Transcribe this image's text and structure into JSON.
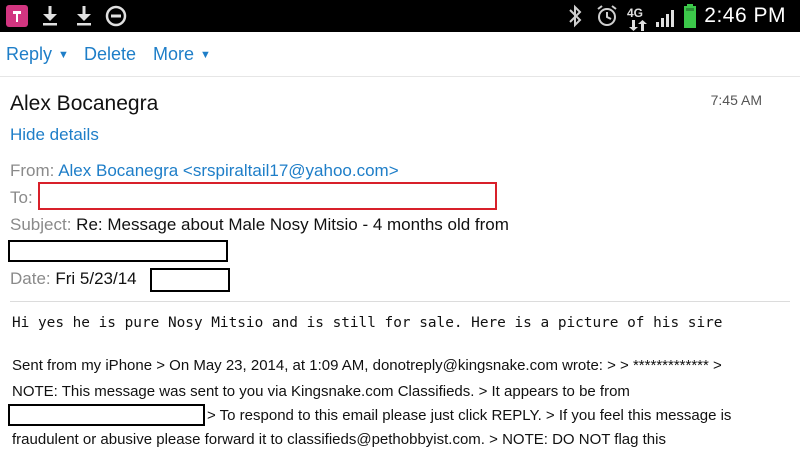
{
  "status_bar": {
    "time": "2:46 PM",
    "icons": [
      "t-mobile-icon",
      "download-icon",
      "download-icon",
      "do-not-disturb-icon",
      "bluetooth-icon",
      "alarm-icon",
      "4g-icon",
      "signal-icon",
      "battery-icon"
    ],
    "network_label": "4G"
  },
  "toolbar": {
    "reply_label": "Reply",
    "delete_label": "Delete",
    "more_label": "More",
    "caret": "▼"
  },
  "message": {
    "sender_name": "Alex Bocanegra",
    "time": "7:45 AM",
    "hide_details_label": "Hide details",
    "from_label": "From:",
    "from_value": "Alex Bocanegra <srspiraltail17@yahoo.com>",
    "to_label": "To:",
    "subject_label": "Subject:",
    "subject_value": "Re: Message about Male Nosy Mitsio - 4 months old from",
    "date_label": "Date:",
    "date_value": "Fri 5/23/14",
    "body_line1": "Hi yes he is pure Nosy Mitsio and is still for sale. Here is a picture of his sire",
    "quoted_line1": "Sent from my iPhone > On May 23, 2014, at 1:09 AM, donotreply@kingsnake.com wrote: > > ************* >",
    "quoted_line2": "NOTE: This message was sent to you via Kingsnake.com Classifieds. > It appears to be from",
    "quoted_line3": "> To respond to this email please just click REPLY. > If you feel this message is",
    "quoted_line4": "fraudulent or abusive please forward it to classifieds@pethobbyist.com. > NOTE: DO NOT flag this"
  },
  "colors": {
    "link": "#1e7ec8",
    "label": "#8a8a8a",
    "redact_red": "#d8202a",
    "redact_black": "#000000",
    "tmobile": "#d23580"
  }
}
